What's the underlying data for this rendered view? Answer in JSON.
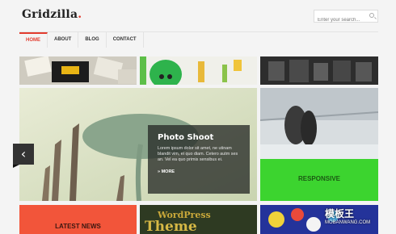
{
  "site": {
    "logo": "Gridzilla",
    "logo_dot": "."
  },
  "search": {
    "placeholder": "Enter your search..."
  },
  "nav": {
    "items": [
      "HOME",
      "ABOUT",
      "BLOG",
      "CONTACT"
    ]
  },
  "hero": {
    "title": "Photo Shoot",
    "body": "Lorem ipsum dolor sit amet, ne utinam blandit vim, ei quo diam. Cetero autm ses an. Vel ea quo primis sensibus ei.",
    "more": "» MORE"
  },
  "tiles": {
    "responsive_label": "RESPONSIVE",
    "news_label": "LATEST NEWS",
    "wp_line1": "WordPress",
    "wp_line2": "Theme"
  },
  "watermark": {
    "line1": "模板王",
    "line2": "MOBANWANG.COM"
  },
  "colors": {
    "accent": "#e23b2e",
    "green": "#3cd42f",
    "orange": "#f2553a"
  }
}
